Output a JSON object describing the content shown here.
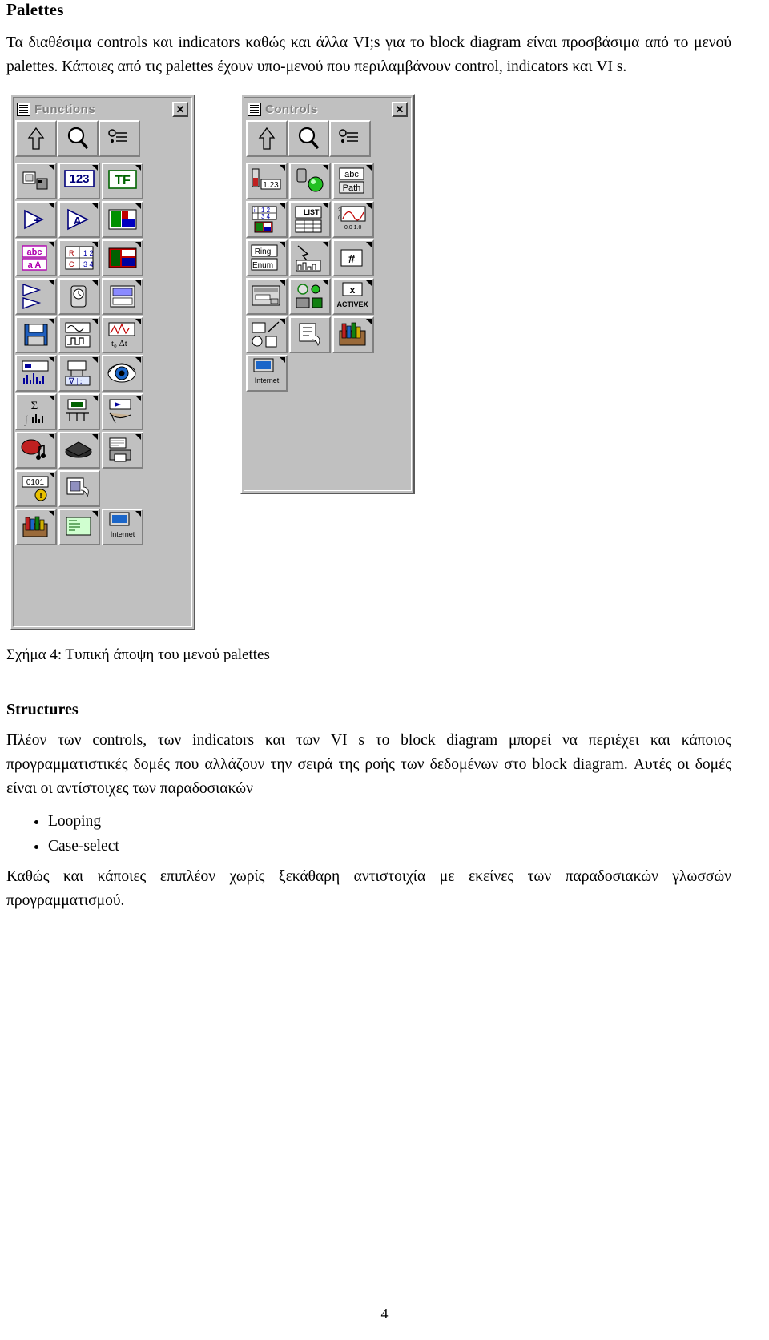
{
  "document": {
    "page_number": "4",
    "sections": [
      {
        "heading": "Palettes",
        "paragraph": "Τα διαθέσιμα controls και indicators καθώς και άλλα VI;s για το block diagram είναι προσβάσιμα από το μενού palettes. Κάποιες από τις palettes έχουν υπο-μενού που περιλαμβάνουν control, indicators και VI s."
      },
      {
        "heading": "Structures",
        "paragraph": "Πλέον των controls, των indicators και των VI s το block diagram μπορεί να περιέχει και κάποιος προγραμματιστικές δομές που αλλάζουν την σειρά της ροής των δεδομένων στο block diagram.  Αυτές οι δομές είναι οι αντίστοιχες των παραδοσιακών",
        "bullets": [
          "Looping",
          "Case-select"
        ],
        "closing": "Καθώς και κάποιες επιπλέον χωρίς ξεκάθαρη αντιστοιχία με εκείνες των παραδοσιακών γλωσσών προγραμματισμού."
      }
    ],
    "figure_caption": "Σχήμα 4:  Τυπική άποψη του μενού palettes"
  },
  "functions_palette": {
    "title": "Functions",
    "close_label": "✕",
    "toolbar": [
      "up-arrow-icon",
      "search-icon",
      "options-icon",
      "blank"
    ],
    "cells": [
      {
        "label": "",
        "icon": "structures-icon",
        "arrow": true
      },
      {
        "label": "123",
        "icon": "numeric-icon",
        "arrow": true
      },
      {
        "label": "TF",
        "icon": "boolean-icon",
        "arrow": true
      },
      {
        "label": "",
        "icon": "arithmetic-icon",
        "arrow": true
      },
      {
        "label": "A",
        "icon": "comparison-icon",
        "arrow": true
      },
      {
        "label": "abc",
        "icon": "string-icon",
        "arrow": true
      },
      {
        "label": "R12 C34",
        "icon": "array-cluster-icon",
        "arrow": true
      },
      {
        "label": "",
        "icon": "color-icon",
        "arrow": true
      },
      {
        "label": "",
        "icon": "time-dialog-icon",
        "arrow": true
      },
      {
        "label": "",
        "icon": "clock-icon",
        "arrow": true
      },
      {
        "label": "",
        "icon": "file-io-icon",
        "arrow": true
      },
      {
        "label": "",
        "icon": "save-icon",
        "arrow": true
      },
      {
        "label": "",
        "icon": "waveform-icon",
        "arrow": true
      },
      {
        "label": "",
        "icon": "analysis-icon",
        "arrow": true
      },
      {
        "label": "",
        "icon": "signal-icon",
        "arrow": true
      },
      {
        "label": "",
        "icon": "math-icon",
        "arrow": true
      },
      {
        "label": "Σ",
        "icon": "sigma-icon",
        "arrow": true
      },
      {
        "label": "",
        "icon": "integral-icon",
        "arrow": true
      },
      {
        "label": "",
        "icon": "instrument-icon",
        "arrow": true
      },
      {
        "label": "",
        "icon": "daq-icon",
        "arrow": true
      },
      {
        "label": "",
        "icon": "music-icon",
        "arrow": true
      },
      {
        "label": "",
        "icon": "tutorial-icon",
        "arrow": true
      },
      {
        "label": "",
        "icon": "report-icon",
        "arrow": true
      },
      {
        "label": "0101",
        "icon": "advanced-icon",
        "arrow": true
      },
      {
        "label": "",
        "icon": "select-vi-icon",
        "arrow": false
      },
      {
        "label": "",
        "icon": "user-libraries-icon",
        "arrow": true
      },
      {
        "label": "",
        "icon": "application-control-icon",
        "arrow": true
      },
      {
        "label": "Internet",
        "icon": "internet-icon",
        "arrow": true
      }
    ]
  },
  "controls_palette": {
    "title": "Controls",
    "close_label": "✕",
    "toolbar": [
      "up-arrow-icon",
      "search-icon",
      "options-icon",
      "blank"
    ],
    "cells": [
      {
        "label": "1.23",
        "icon": "numeric-control-icon",
        "arrow": true
      },
      {
        "label": "",
        "icon": "boolean-led-icon",
        "arrow": true
      },
      {
        "label": "abc Path",
        "icon": "string-path-icon",
        "arrow": true
      },
      {
        "label": "i 1 2 3 4",
        "icon": "array-cluster-icon",
        "arrow": true
      },
      {
        "label": "LIST",
        "icon": "list-table-icon",
        "arrow": true
      },
      {
        "label": "0.0 1.0",
        "icon": "graph-icon",
        "arrow": true
      },
      {
        "label": "Ring Enum",
        "icon": "ring-enum-icon",
        "arrow": true
      },
      {
        "label": "",
        "icon": "io-icon",
        "arrow": true
      },
      {
        "label": "#",
        "icon": "refnum-icon",
        "arrow": true
      },
      {
        "label": "",
        "icon": "dialog-controls-icon",
        "arrow": true
      },
      {
        "label": "",
        "icon": "classic-controls-icon",
        "arrow": true
      },
      {
        "label": "ACTIVEX",
        "icon": "activex-icon",
        "arrow": true
      },
      {
        "label": "",
        "icon": "decorations-icon",
        "arrow": true
      },
      {
        "label": "",
        "icon": "select-control-icon",
        "arrow": false
      },
      {
        "label": "",
        "icon": "user-controls-icon",
        "arrow": true
      },
      {
        "label": "Internet",
        "icon": "internet-icon",
        "arrow": true
      }
    ]
  }
}
